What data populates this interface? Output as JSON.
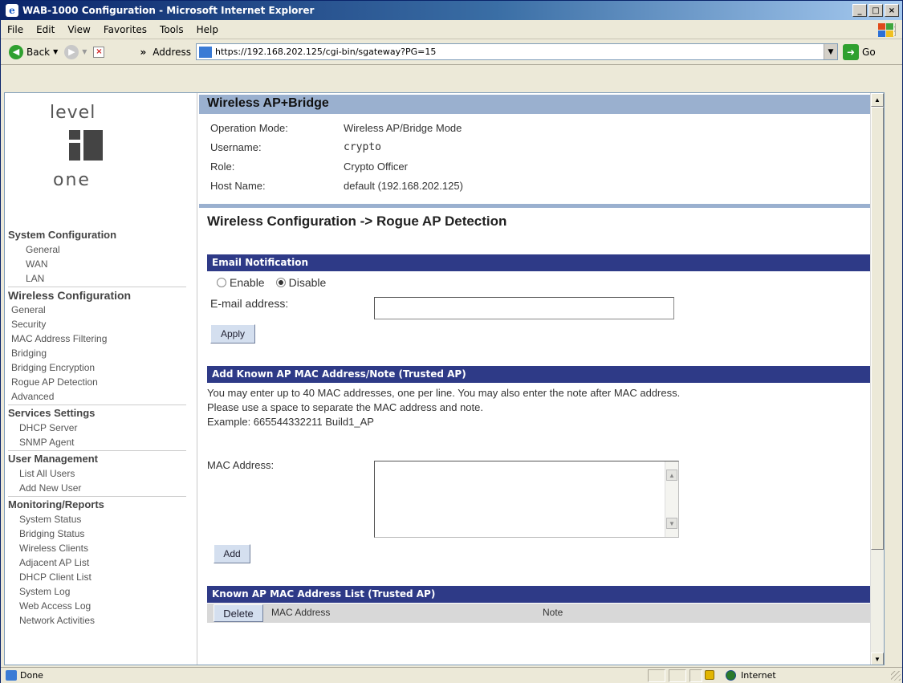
{
  "window": {
    "title": "WAB-1000 Configuration - Microsoft Internet Explorer"
  },
  "menu": [
    "File",
    "Edit",
    "View",
    "Favorites",
    "Tools",
    "Help"
  ],
  "toolbar": {
    "back_label": "Back",
    "address_label": "Address",
    "url": "https://192.168.202.125/cgi-bin/sgateway?PG=15",
    "go_label": "Go"
  },
  "logo": {
    "top": "level",
    "bottom": "one"
  },
  "sidebar": {
    "system": {
      "title": "System Configuration",
      "items": [
        "General",
        "WAN",
        "LAN"
      ]
    },
    "wireless": {
      "title": "Wireless Configuration",
      "items": [
        "General",
        "Security",
        "MAC Address Filtering",
        "Bridging",
        "Bridging Encryption",
        "Rogue AP Detection",
        "Advanced"
      ]
    },
    "services": {
      "title": "Services Settings",
      "items": [
        "DHCP Server",
        "SNMP Agent"
      ]
    },
    "users": {
      "title": "User Management",
      "items": [
        "List All Users",
        "Add New User"
      ]
    },
    "monitoring": {
      "title": "Monitoring/Reports",
      "items": [
        "System Status",
        "Bridging Status",
        "Wireless Clients",
        "Adjacent AP List",
        "DHCP Client List",
        "System Log",
        "Web Access Log",
        "Network Activities"
      ]
    }
  },
  "header": {
    "title": "Wireless AP+Bridge",
    "rows": [
      {
        "label": "Operation Mode:",
        "value": "Wireless AP/Bridge Mode"
      },
      {
        "label": "Username:",
        "value": "crypto"
      },
      {
        "label": "Role:",
        "value": "Crypto Officer"
      },
      {
        "label": "Host Name:",
        "value": "default (192.168.202.125)"
      }
    ]
  },
  "page_title": "Wireless Configuration -> Rogue AP Detection",
  "email": {
    "section": "Email Notification",
    "enable": "Enable",
    "disable": "Disable",
    "selected": "Disable",
    "address_label": "E-mail address:",
    "address_value": "",
    "apply": "Apply"
  },
  "known_ap": {
    "section": "Add Known AP MAC Address/Note (Trusted AP)",
    "line1": "You may enter up to 40 MAC addresses, one per line. You may also enter the note after MAC address.",
    "line2": "Please use a space to separate the MAC address and note.",
    "line3": "Example: 665544332211 Build1_AP",
    "mac_label": "MAC Address:",
    "add": "Add"
  },
  "list": {
    "section": "Known AP MAC Address List (Trusted AP)",
    "delete": "Delete",
    "col_mac": "MAC Address",
    "col_note": "Note"
  },
  "status": {
    "text": "Done",
    "zone": "Internet"
  }
}
